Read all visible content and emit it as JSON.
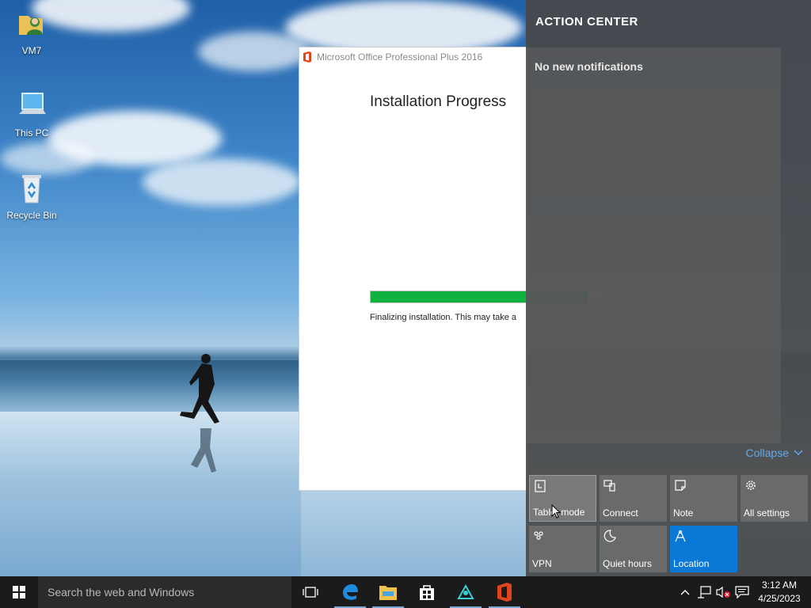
{
  "desktop": {
    "icons": [
      {
        "label": "VM7",
        "icon": "user-folder-icon"
      },
      {
        "label": "This PC",
        "icon": "computer-icon"
      },
      {
        "label": "Recycle Bin",
        "icon": "recycle-bin-icon"
      }
    ]
  },
  "installer": {
    "title": "Microsoft Office Professional Plus 2016",
    "heading": "Installation Progress",
    "progress_percent": 92,
    "status": "Finalizing installation. This may take a"
  },
  "action_center": {
    "title": "ACTION CENTER",
    "no_notifications": "No new notifications",
    "collapse_label": "Collapse",
    "tiles": [
      {
        "label": "Tablet mode",
        "icon": "tablet-mode-icon",
        "active": false
      },
      {
        "label": "Connect",
        "icon": "connect-icon",
        "active": false
      },
      {
        "label": "Note",
        "icon": "note-icon",
        "active": false
      },
      {
        "label": "All settings",
        "icon": "gear-icon",
        "active": false
      },
      {
        "label": "VPN",
        "icon": "vpn-icon",
        "active": false
      },
      {
        "label": "Quiet hours",
        "icon": "moon-icon",
        "active": false
      },
      {
        "label": "Location",
        "icon": "location-icon",
        "active": true
      }
    ],
    "accent_color": "#0a78d7"
  },
  "taskbar": {
    "search_placeholder": "Search the web and Windows",
    "apps": [
      "task-view-icon",
      "edge-icon",
      "file-explorer-icon",
      "store-icon",
      "app-icon",
      "office-icon"
    ],
    "clock_time": "3:12 AM",
    "clock_date": "4/25/2023"
  }
}
